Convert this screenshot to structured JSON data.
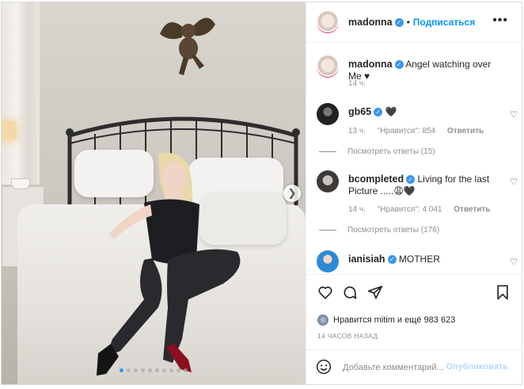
{
  "post": {
    "author": "madonna",
    "follow_label": "Подписаться",
    "separator": "•",
    "caption_text": "Angel watching over Me ♥",
    "caption_time": "14 ч.",
    "image_description": "Woman in fishnet bodysuit reclining on a bed under a cherub sculpture",
    "slide_count": 10,
    "active_slide": 1
  },
  "comments": [
    {
      "username": "gb65",
      "text": "🖤",
      "time": "13 ч.",
      "likes": "\"Нравится\": 854",
      "reply": "Ответить",
      "view_replies": "Посмотреть ответы (15)"
    },
    {
      "username": "bcompleted",
      "text": "Living for the last Picture .....😩🖤",
      "time": "14 ч.",
      "likes": "\"Нравится\": 4 041",
      "reply": "Ответить",
      "view_replies": "Посмотреть ответы (176)"
    },
    {
      "username": "ianisiah",
      "text": "MOTHER",
      "time": "",
      "likes": "",
      "reply": "",
      "view_replies": ""
    }
  ],
  "likes_summary": "Нравится mitim и ещё 983 623",
  "timestamp": "14 ЧАСОВ НАЗАД",
  "composer": {
    "placeholder": "Добавьте комментарий...",
    "publish_label": "Опубликовать"
  },
  "colors": {
    "accent": "#0095f6",
    "verified": "#3897f0",
    "muted": "#8e8e8e",
    "publish_disabled": "#b3dbff"
  },
  "icons": [
    "heart-icon",
    "comment-icon",
    "share-icon",
    "bookmark-icon",
    "emoji-icon",
    "more-icon",
    "verified-icon",
    "next-arrow-icon"
  ]
}
